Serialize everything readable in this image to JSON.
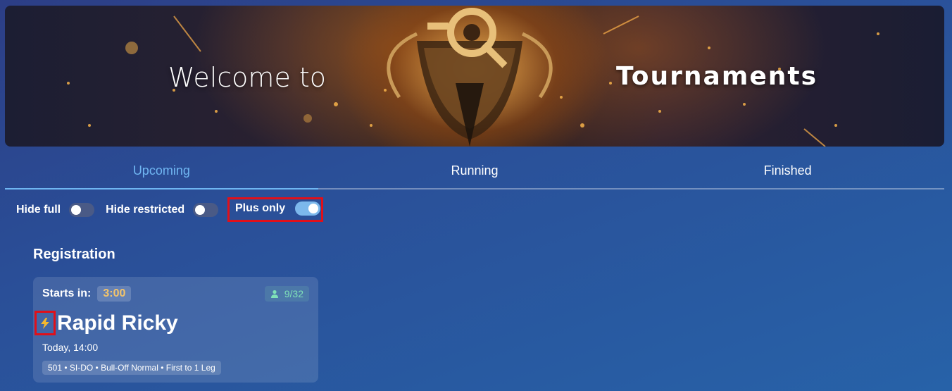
{
  "banner": {
    "welcome_text": "Welcome to",
    "title_text": "Tournaments"
  },
  "tabs": [
    {
      "label": "Upcoming",
      "active": true
    },
    {
      "label": "Running",
      "active": false
    },
    {
      "label": "Finished",
      "active": false
    }
  ],
  "filters": {
    "hide_full": {
      "label": "Hide full",
      "on": false
    },
    "hide_restricted": {
      "label": "Hide restricted",
      "on": false
    },
    "plus_only": {
      "label": "Plus only",
      "on": true
    }
  },
  "section": {
    "title": "Registration"
  },
  "card": {
    "starts_label": "Starts in:",
    "countdown": "3:00",
    "players": "9/32",
    "icon": "lightning-bolt-icon",
    "name": "Rapid Ricky",
    "date": "Today, 14:00",
    "format": "501 • SI-DO • Bull-Off Normal • First to 1 Leg"
  },
  "colors": {
    "active_tab": "#6fb6f2",
    "highlight_border": "#e0101a",
    "countdown_text": "#f4c46a",
    "players_text": "#7fe0b8",
    "toggle_on": "#7cb8ec",
    "toggle_off": "#4a5a86"
  }
}
